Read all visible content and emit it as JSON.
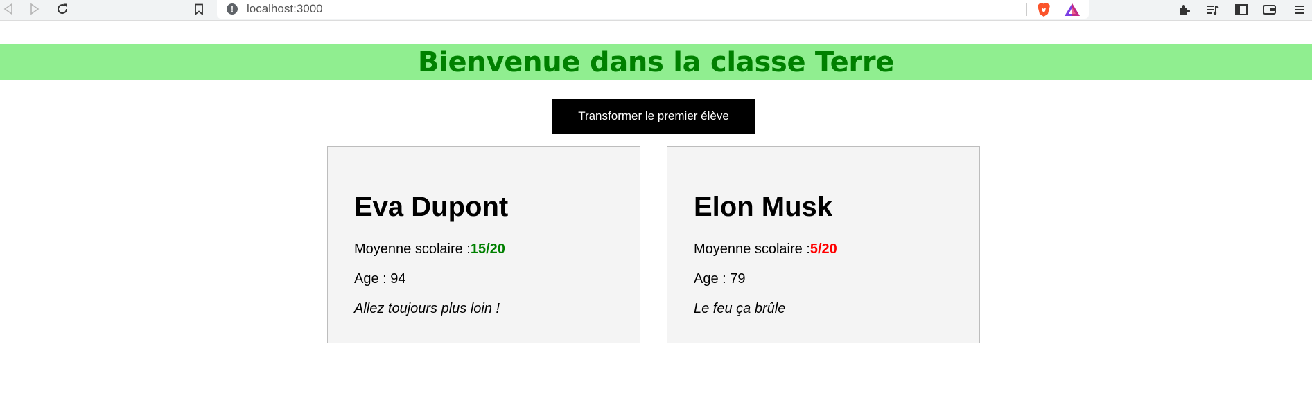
{
  "browser": {
    "url": "localhost:3000",
    "info_glyph": "!",
    "icons": [
      "back-icon",
      "forward-icon",
      "reload-icon",
      "bookmark-icon",
      "site-info-icon",
      "brave-shields-icon",
      "brave-rewards-icon",
      "extensions-icon",
      "playlist-icon",
      "sidebar-icon",
      "wallet-icon",
      "menu-icon"
    ]
  },
  "page": {
    "title": "Bienvenue dans la classe Terre",
    "transform_button_label": "Transformer le premier élève"
  },
  "colors": {
    "banner_bg": "#90ee90",
    "banner_text": "#008000",
    "grade_good": "#008000",
    "grade_bad": "#ff0000",
    "card_bg": "#f4f4f4"
  },
  "students": [
    {
      "name": "Eva Dupont",
      "average_label": "Moyenne scolaire :",
      "average_value": "15/20",
      "age_label": "Age : ",
      "age": "94",
      "quote": "Allez toujours plus loin !"
    },
    {
      "name": "Elon Musk",
      "average_label": "Moyenne scolaire :",
      "average_value": "5/20",
      "age_label": "Age : ",
      "age": "79",
      "quote": "Le feu ça brûle"
    }
  ]
}
